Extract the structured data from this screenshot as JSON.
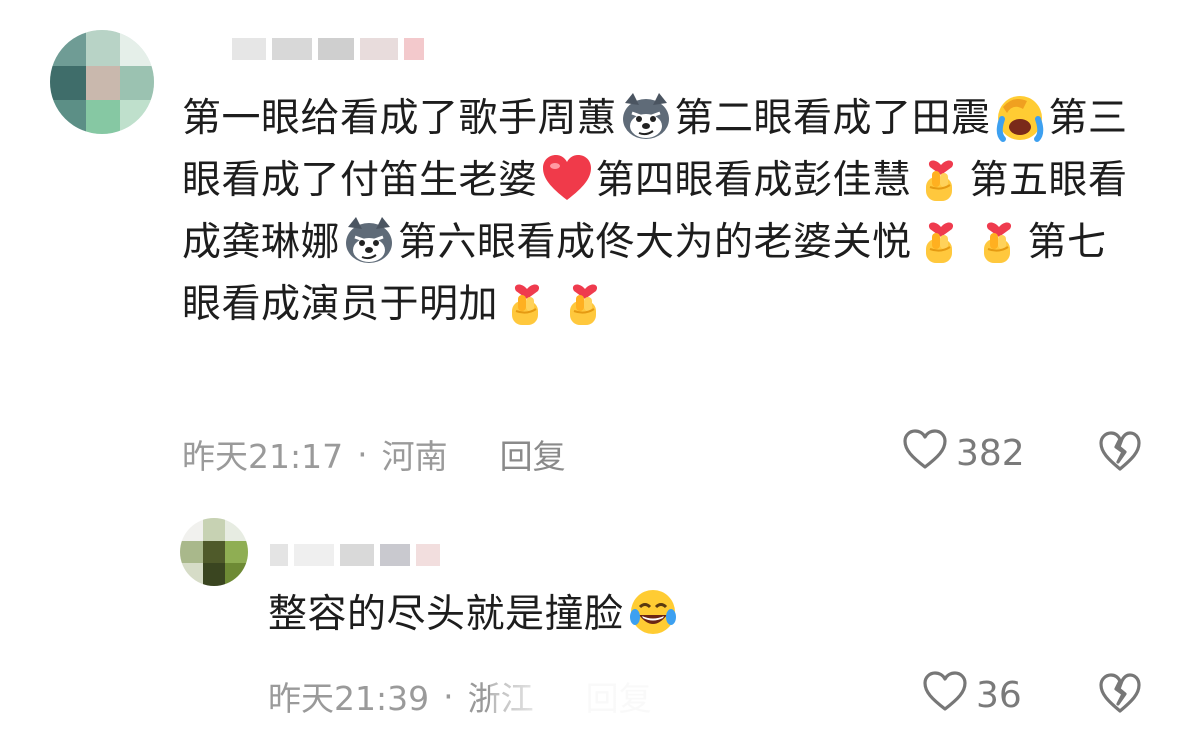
{
  "comments": [
    {
      "segments": [
        {
          "type": "text",
          "value": "第一眼给看成了歌手周蕙"
        },
        {
          "type": "emoji",
          "name": "wolf-emoji"
        },
        {
          "type": "text",
          "value": "第二眼看成了田震"
        },
        {
          "type": "emoji",
          "name": "facepalm-crying-emoji"
        },
        {
          "type": "text",
          "value": "第三眼看成了付笛生老婆"
        },
        {
          "type": "emoji",
          "name": "red-heart-emoji"
        },
        {
          "type": "text",
          "value": "第四眼看成彭佳慧"
        },
        {
          "type": "emoji",
          "name": "finger-heart-emoji"
        },
        {
          "type": "text",
          "value": "第五眼看成龚琳娜"
        },
        {
          "type": "emoji",
          "name": "wolf-emoji"
        },
        {
          "type": "text",
          "value": "第六眼看成佟大为的老婆关悦"
        },
        {
          "type": "emoji",
          "name": "finger-heart-emoji"
        },
        {
          "type": "emoji",
          "name": "finger-heart-emoji"
        },
        {
          "type": "text",
          "value": "第七眼看成演员于明加"
        },
        {
          "type": "emoji",
          "name": "finger-heart-emoji"
        },
        {
          "type": "emoji",
          "name": "finger-heart-emoji"
        }
      ],
      "time": "昨天21:17",
      "separator": "·",
      "location": "河南",
      "reply_label": "回复",
      "likes": "382"
    },
    {
      "segments": [
        {
          "type": "text",
          "value": "整容的尽头就是撞脸"
        },
        {
          "type": "emoji",
          "name": "tears-of-joy-emoji"
        }
      ],
      "time": "昨天21:39",
      "separator": "·",
      "location": "浙江",
      "reply_label": "回复",
      "likes": "36"
    }
  ],
  "colors": {
    "meta_text": "#9a9a9a",
    "heart_outline": "#777777",
    "body_text": "#1d1d1d"
  }
}
